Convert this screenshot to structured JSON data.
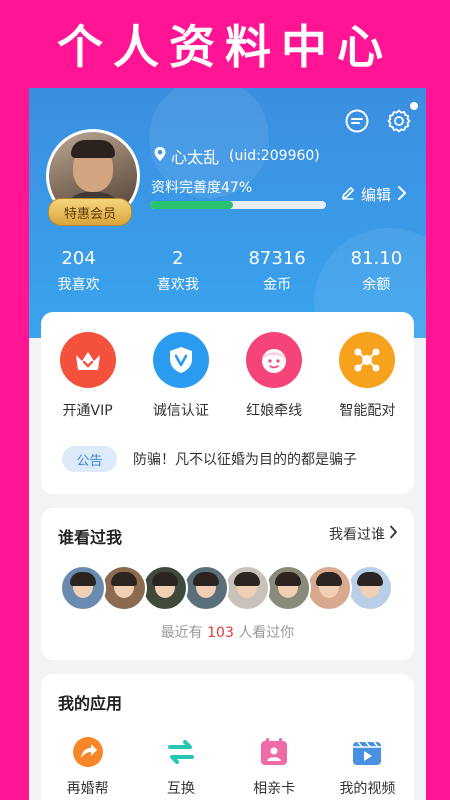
{
  "banner": {
    "title": "个人资料中心"
  },
  "profile": {
    "badge": "特惠会员",
    "username": "心太乱",
    "uid": "(uid:209960)",
    "completeness_label": "资料完善度47%",
    "completeness_value": 47,
    "edit_label": "编辑"
  },
  "stats": [
    {
      "value": "204",
      "label": "我喜欢"
    },
    {
      "value": "2",
      "label": "喜欢我"
    },
    {
      "value": "87316",
      "label": "金币"
    },
    {
      "value": "81.10",
      "label": "余额"
    }
  ],
  "features": [
    {
      "label": "开通VIP",
      "icon": "crown-icon",
      "color": "#f4513c"
    },
    {
      "label": "诚信认证",
      "icon": "shield-check-icon",
      "color": "#2b9bf0"
    },
    {
      "label": "红娘牵线",
      "icon": "matchmaker-icon",
      "color": "#f5447a"
    },
    {
      "label": "智能配对",
      "icon": "network-icon",
      "color": "#f7a21c"
    }
  ],
  "notice": {
    "tag": "公告",
    "text": "防骗！凡不以征婚为目的的都是骗子"
  },
  "viewers": {
    "title": "谁看过我",
    "see_more": "我看过谁",
    "count_prefix": "最近有",
    "count": "103",
    "count_suffix": "人看过你",
    "avatars": [
      "#6a8bb0",
      "#8b6a4f",
      "#3f4a3a",
      "#5b6f7a",
      "#c9c2bb",
      "#8a8a7a",
      "#d9a98f",
      "#b9cfe8"
    ]
  },
  "apps": {
    "title": "我的应用",
    "items": [
      {
        "label": "再婚帮",
        "icon": "share-arrow-icon",
        "color": "#f7862a"
      },
      {
        "label": "互换",
        "icon": "swap-icon",
        "color": "#26c6b3"
      },
      {
        "label": "相亲卡",
        "icon": "calendar-card-icon",
        "color": "#f06aa8"
      },
      {
        "label": "我的视频",
        "icon": "video-icon",
        "color": "#4a90e2"
      }
    ]
  }
}
